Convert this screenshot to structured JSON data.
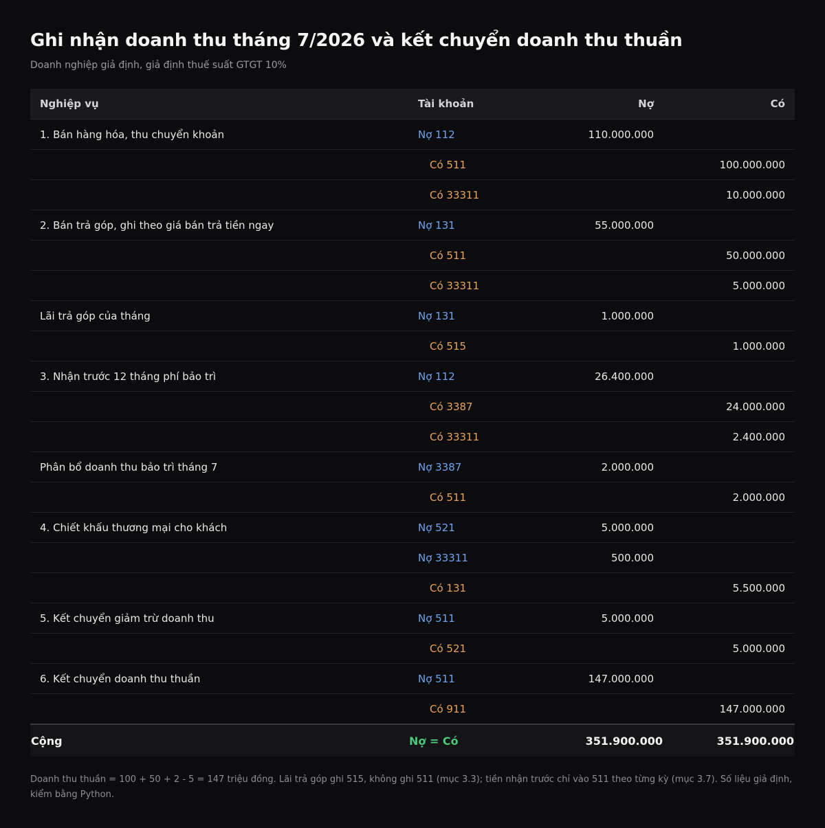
{
  "title": "Ghi nhận doanh thu tháng 7/2026 và kết chuyển doanh thu thuần",
  "subtitle": "Doanh nghiệp giả định, giả định thuế suất GTGT 10%",
  "columns": [
    "Nghiệp vụ",
    "Tài khoản",
    "Nợ",
    "Có"
  ],
  "rows": [
    {
      "desc": "1. Bán hàng hóa, thu chuyển khoản",
      "side": "debit",
      "account": "Nợ 112",
      "debit": "110.000.000",
      "credit": ""
    },
    {
      "desc": "",
      "side": "credit",
      "account": "Có 511",
      "debit": "",
      "credit": "100.000.000"
    },
    {
      "desc": "",
      "side": "credit",
      "account": "Có 33311",
      "debit": "",
      "credit": "10.000.000"
    },
    {
      "desc": "2. Bán trả góp, ghi theo giá bán trả tiền ngay",
      "side": "debit",
      "account": "Nợ 131",
      "debit": "55.000.000",
      "credit": ""
    },
    {
      "desc": "",
      "side": "credit",
      "account": "Có 511",
      "debit": "",
      "credit": "50.000.000"
    },
    {
      "desc": "",
      "side": "credit",
      "account": "Có 33311",
      "debit": "",
      "credit": "5.000.000"
    },
    {
      "desc": "Lãi trả góp của tháng",
      "side": "debit",
      "account": "Nợ 131",
      "debit": "1.000.000",
      "credit": ""
    },
    {
      "desc": "",
      "side": "credit",
      "account": "Có 515",
      "debit": "",
      "credit": "1.000.000"
    },
    {
      "desc": "3. Nhận trước 12 tháng phí bảo trì",
      "side": "debit",
      "account": "Nợ 112",
      "debit": "26.400.000",
      "credit": ""
    },
    {
      "desc": "",
      "side": "credit",
      "account": "Có 3387",
      "debit": "",
      "credit": "24.000.000"
    },
    {
      "desc": "",
      "side": "credit",
      "account": "Có 33311",
      "debit": "",
      "credit": "2.400.000"
    },
    {
      "desc": "Phân bổ doanh thu bảo trì tháng 7",
      "side": "debit",
      "account": "Nợ 3387",
      "debit": "2.000.000",
      "credit": ""
    },
    {
      "desc": "",
      "side": "credit",
      "account": "Có 511",
      "debit": "",
      "credit": "2.000.000"
    },
    {
      "desc": "4. Chiết khấu thương mại cho khách",
      "side": "debit",
      "account": "Nợ 521",
      "debit": "5.000.000",
      "credit": ""
    },
    {
      "desc": "",
      "side": "debit",
      "account": "Nợ 33311",
      "debit": "500.000",
      "credit": ""
    },
    {
      "desc": "",
      "side": "credit",
      "account": "Có 131",
      "debit": "",
      "credit": "5.500.000"
    },
    {
      "desc": "5. Kết chuyển giảm trừ doanh thu",
      "side": "debit",
      "account": "Nợ 511",
      "debit": "5.000.000",
      "credit": ""
    },
    {
      "desc": "",
      "side": "credit",
      "account": "Có 521",
      "debit": "",
      "credit": "5.000.000"
    },
    {
      "desc": "6. Kết chuyển doanh thu thuần",
      "side": "debit",
      "account": "Nợ 511",
      "debit": "147.000.000",
      "credit": ""
    },
    {
      "desc": "",
      "side": "credit",
      "account": "Có 911",
      "debit": "",
      "credit": "147.000.000"
    }
  ],
  "total": {
    "label": "Cộng",
    "check": "Nợ = Có",
    "debit": "351.900.000",
    "credit": "351.900.000"
  },
  "note": "Doanh thu thuần = 100 + 50 + 2 - 5 = 147 triệu đồng. Lãi trả góp ghi 515, không ghi 511 (mục 3.3); tiền nhận trước chỉ vào 511 theo từng kỳ (mục 3.7). Số liệu giả định, kiểm bằng Python.",
  "colors": {
    "debit_account": "#6fa4f2",
    "credit_account": "#e8a45a",
    "balance_check": "#4cc67a"
  }
}
